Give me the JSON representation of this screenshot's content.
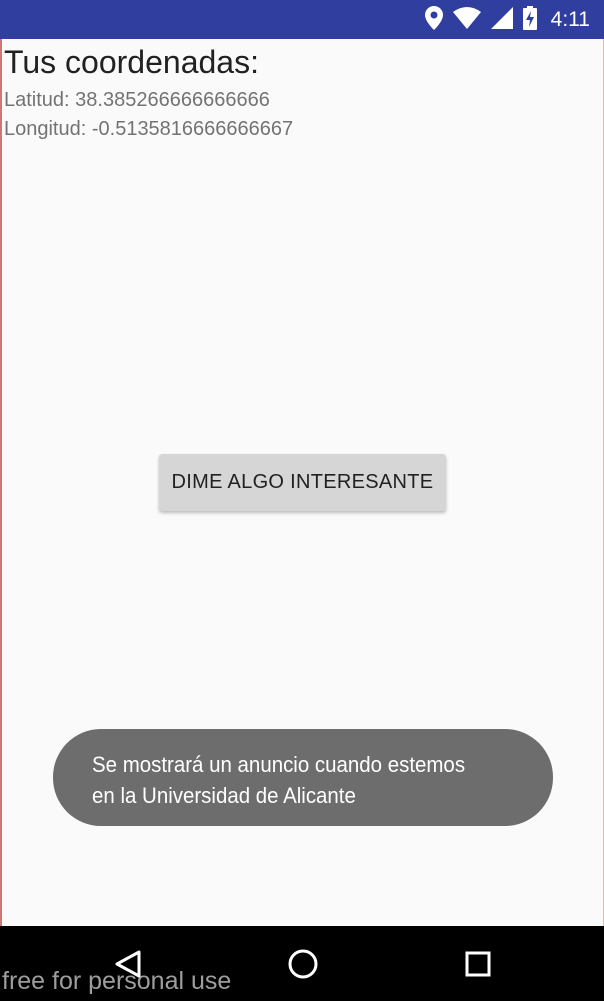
{
  "status_bar": {
    "time": "4:11",
    "icons": [
      "location-pin-icon",
      "wifi-icon",
      "cell-signal-icon",
      "battery-charging-icon"
    ]
  },
  "main": {
    "title": "Tus coordenadas:",
    "latitude_text": "Latitud: 38.385266666666666",
    "longitude_text": "Longitud: -0.5135816666666667",
    "button_label": "DIME ALGO INTERESANTE"
  },
  "toast": {
    "line1": "Se mostrará un anuncio cuando estemos",
    "line2": "en la Universidad de Alicante"
  },
  "nav_bar": {
    "icons": [
      "back-icon",
      "home-icon",
      "recents-icon"
    ]
  },
  "watermark": "free for personal use",
  "colors": {
    "status_bar": "#303f9f",
    "background": "#fafafa",
    "button": "#d6d6d6",
    "toast": "#6d6d6d",
    "nav_bar": "#000000"
  }
}
